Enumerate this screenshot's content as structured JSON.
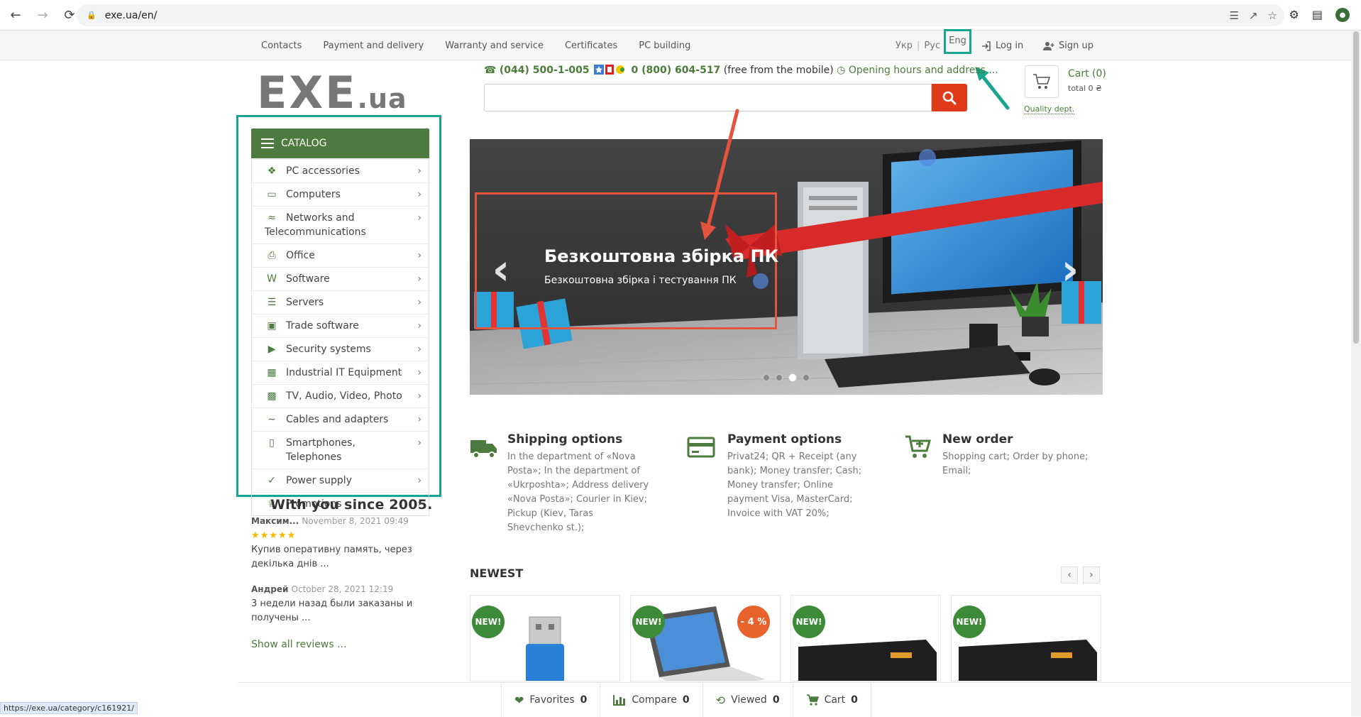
{
  "browser": {
    "url": "exe.ua/en/",
    "status_url": "https://exe.ua/category/c161921/"
  },
  "topnav": {
    "links": [
      "Contacts",
      "Payment and delivery",
      "Warranty and service",
      "Certificates",
      "PC building"
    ],
    "lang_ukr": "Укр",
    "lang_rus": "Рус",
    "lang_eng": "Eng",
    "lang_sep": "|",
    "login": "Log in",
    "signup": "Sign up"
  },
  "header": {
    "logo_main": "EXE",
    "logo_ua": ".ua",
    "phone1": "(044) 500-1-005",
    "phone2": "0 (800) 604-517",
    "phone2_note": "(free from the mobile)",
    "hours": "Opening hours and address ...",
    "cart_label": "Cart (0)",
    "cart_total": "total 0 ₴",
    "quality": "Quality dept."
  },
  "catalog": {
    "title": "CATALOG",
    "items": [
      {
        "label": "PC accessories",
        "icon": "puzzle-icon"
      },
      {
        "label": "Computers",
        "icon": "laptop-icon"
      },
      {
        "label": "Networks and",
        "label2": "Telecommunications",
        "icon": "wifi-icon"
      },
      {
        "label": "Office",
        "icon": "printer-icon"
      },
      {
        "label": "Software",
        "icon": "word-doc-icon"
      },
      {
        "label": "Servers",
        "icon": "server-icon"
      },
      {
        "label": "Trade software",
        "icon": "cash-register-icon"
      },
      {
        "label": "Security systems",
        "icon": "video-camera-icon"
      },
      {
        "label": "Industrial IT Equipment",
        "icon": "factory-icon"
      },
      {
        "label": "TV, Audio, Video, Photo",
        "icon": "monitor-icon"
      },
      {
        "label": "Cables and adapters",
        "icon": "usb-icon"
      },
      {
        "label": "Smartphones, Telephones",
        "icon": "smartphone-icon"
      },
      {
        "label": "Power supply",
        "icon": "plug-icon"
      },
      {
        "label": "Promotions",
        "icon": "trophy-icon"
      }
    ]
  },
  "reviews": {
    "title": "With you since 2005.",
    "items": [
      {
        "name": "Максим...",
        "date": "November 8, 2021 09:49",
        "stars": "★★★★★",
        "text": "Купив оперативну память, через декілька днів ..."
      },
      {
        "name": "Андрей",
        "date": "October 28, 2021 12:19",
        "text": "3 недели назад были заказаны и получены ..."
      }
    ],
    "show_all": "Show all reviews ..."
  },
  "banner": {
    "title": "Безкоштовна збірка ПК",
    "subtitle": "Безкоштовна збірка і тестування ПК",
    "prev": "‹",
    "next": "›"
  },
  "features": [
    {
      "title": "Shipping options",
      "text": "In the department of «Nova Posta»;  In the department of «Ukrposhta»;  Address delivery «Nova Posta»;  Courier in Kiev;  Pickup (Kiev, Taras Shevchenko st.);",
      "icon": "truck-icon"
    },
    {
      "title": "Payment options",
      "text": "Privat24;  QR + Receipt (any bank);  Money transfer;  Cash;  Money transfer;  Online payment Visa, MasterCard;  Invoice with VAT 20%;",
      "icon": "credit-card-icon"
    },
    {
      "title": "New order",
      "text": "Shopping cart; Order by phone; Email;",
      "icon": "cart-plus-icon"
    }
  ],
  "newest": {
    "title": "NEWEST",
    "new_badge": "NEW!",
    "discount_badge": "- 4 %",
    "prev": "‹",
    "next": "›"
  },
  "bottombar": {
    "favorites": "Favorites",
    "favorites_count": "0",
    "compare": "Compare",
    "compare_count": "0",
    "viewed": "Viewed",
    "viewed_count": "0",
    "cart": "Cart",
    "cart_count": "0"
  },
  "colors": {
    "brand_green": "#4d7a3e",
    "search_red": "#e03b19",
    "annotation_teal": "#1aa590",
    "annotation_red": "#e5533c"
  }
}
